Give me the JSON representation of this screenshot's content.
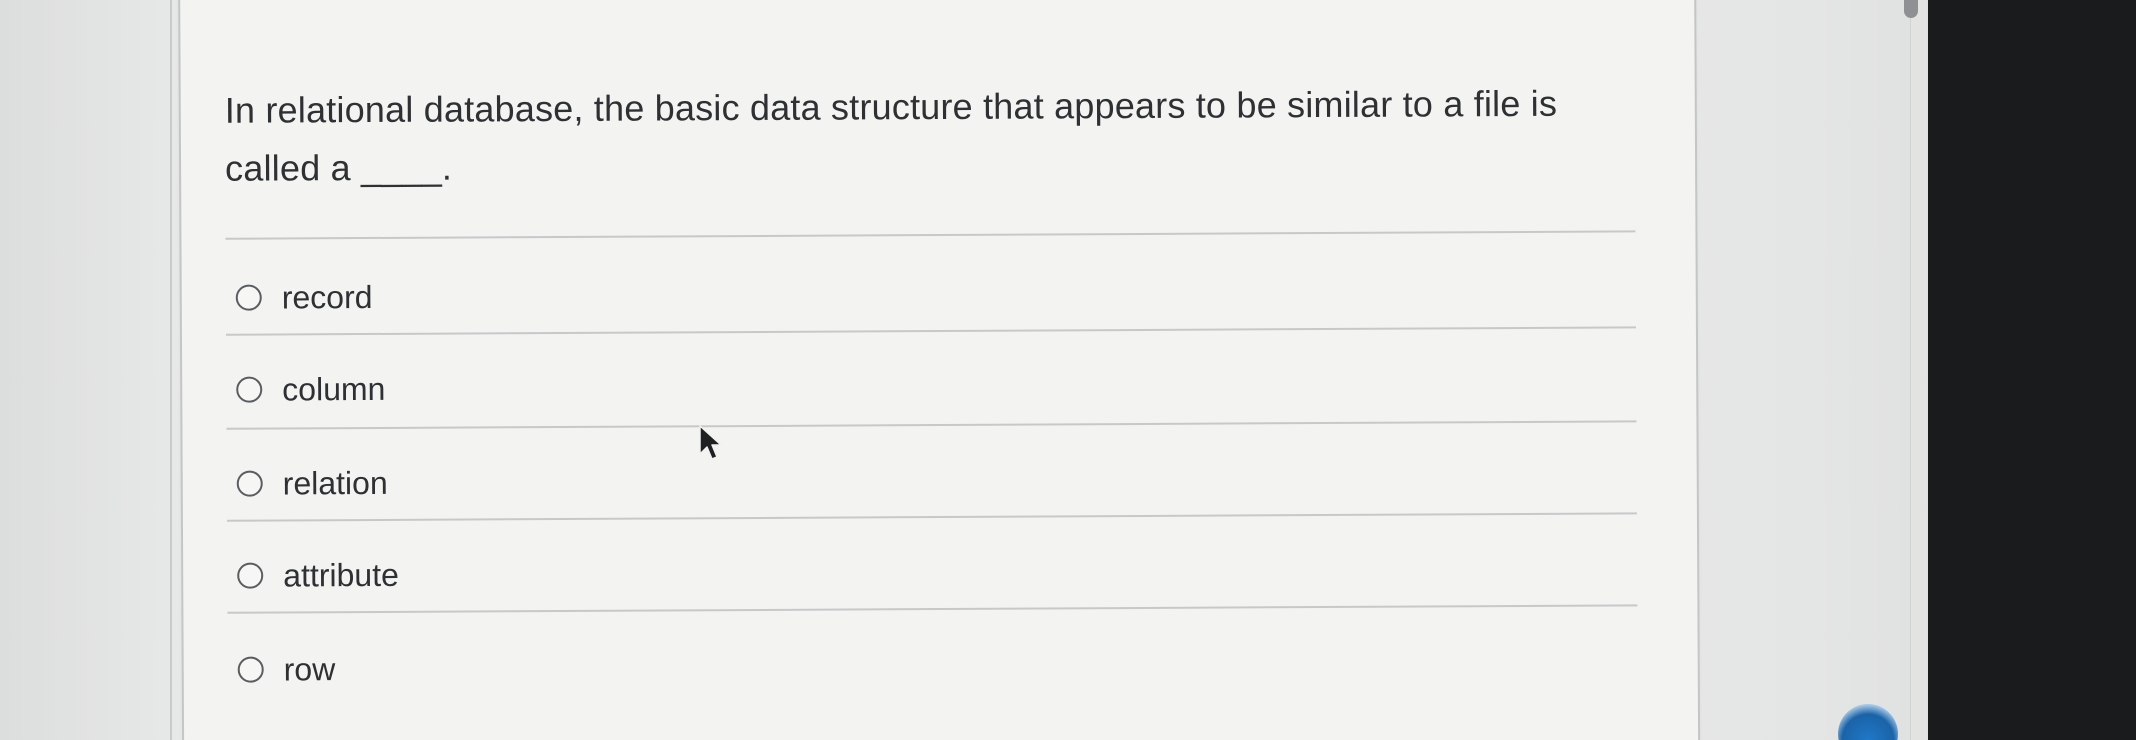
{
  "question": {
    "line1": "In relational database, the basic data structure that appears to be similar to a file is",
    "line2": "called a ____."
  },
  "options": [
    {
      "label": "record",
      "selected": false
    },
    {
      "label": "column",
      "selected": false
    },
    {
      "label": "relation",
      "selected": false
    },
    {
      "label": "attribute",
      "selected": false
    },
    {
      "label": "row",
      "selected": false
    }
  ],
  "icons": {
    "cursor": "arrow-pointer-icon",
    "radio": "radio-unchecked-icon",
    "corner": "help-widget-icon"
  },
  "colors": {
    "text": "#2e3133",
    "divider": "#c7c9c8",
    "card_background": "#f3f3f2",
    "right_panel": "#1a1b1c",
    "widget_accent": "#1f78c8"
  }
}
